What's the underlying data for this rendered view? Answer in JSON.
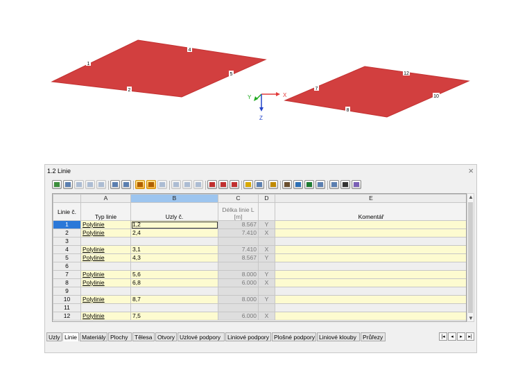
{
  "viewport": {
    "axes": {
      "x": "X",
      "y": "Y",
      "z": "Z"
    },
    "plate1_lines": [
      "1",
      "4",
      "5",
      "2"
    ],
    "plate2_lines": [
      "12",
      "7",
      "10",
      "8"
    ]
  },
  "panel": {
    "title": "1.2 Linie",
    "close": "×"
  },
  "table": {
    "col_letters": [
      "A",
      "B",
      "C",
      "D",
      "E"
    ],
    "headers": {
      "row_no": "Linie č.",
      "type": "Typ linie",
      "nodes": "Uzly č.",
      "length": "Délka linie L [m]",
      "comment": "Komentář"
    },
    "rows": [
      {
        "no": "1",
        "type": "Polylinie",
        "nodes": "1,2",
        "length": "8.567",
        "d": "Y"
      },
      {
        "no": "2",
        "type": "Polylinie",
        "nodes": "2,4",
        "length": "7.410",
        "d": "X"
      },
      {
        "no": "3",
        "type": "",
        "nodes": "",
        "length": "",
        "d": ""
      },
      {
        "no": "4",
        "type": "Polylinie",
        "nodes": "3,1",
        "length": "7.410",
        "d": "X"
      },
      {
        "no": "5",
        "type": "Polylinie",
        "nodes": "4,3",
        "length": "8.567",
        "d": "Y"
      },
      {
        "no": "6",
        "type": "",
        "nodes": "",
        "length": "",
        "d": ""
      },
      {
        "no": "7",
        "type": "Polylinie",
        "nodes": "5,6",
        "length": "8.000",
        "d": "Y"
      },
      {
        "no": "8",
        "type": "Polylinie",
        "nodes": "6,8",
        "length": "6.000",
        "d": "X"
      },
      {
        "no": "9",
        "type": "",
        "nodes": "",
        "length": "",
        "d": ""
      },
      {
        "no": "10",
        "type": "Polylinie",
        "nodes": "8,7",
        "length": "8.000",
        "d": "Y"
      },
      {
        "no": "11",
        "type": "",
        "nodes": "",
        "length": "",
        "d": ""
      },
      {
        "no": "12",
        "type": "Polylinie",
        "nodes": "7,5",
        "length": "6.000",
        "d": "X"
      }
    ]
  },
  "tabs": [
    "Uzly",
    "Linie",
    "Materiály",
    "Plochy",
    "Tělesa",
    "Otvory",
    "Uzlové podpory",
    "Liniové podpory",
    "Plošné podpory",
    "Liniové klouby",
    "Průřezy"
  ],
  "active_tab": "Linie",
  "tab_nav": [
    "|◂",
    "◂",
    "▸",
    "▸|"
  ],
  "colors": {
    "plate": "#d23f3f",
    "selection": "#2b78d8",
    "input_cell": "#fdfbd0"
  }
}
